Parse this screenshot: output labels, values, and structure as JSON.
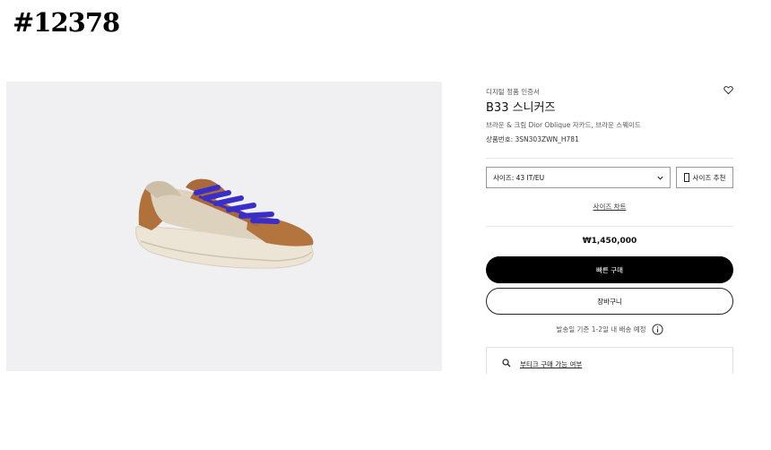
{
  "tag": "#12378",
  "product": {
    "certificate_label": "디지털 정품 인증서",
    "name": "B33 스니커즈",
    "description": "브라운 & 크림 Dior Oblique 자카드, 브라운 스웨이드",
    "code": "상품번호: 3SN303ZWN_H781"
  },
  "size": {
    "select_label": "사이즈: 43  IT/EU",
    "recommend_label": "사이즈 추천",
    "chart_link": "사이즈 차트"
  },
  "price": "₩1,450,000",
  "buttons": {
    "buy_now": "빠른 구매",
    "cart": "장바구니"
  },
  "shipping_note": "발송일 기준 1-2일 내 배송 예정",
  "boutique_link": "부티크 구매 가능 여부",
  "icons": {
    "wishlist": "heart-icon",
    "chevron": "chevron-down-icon",
    "ruler": "ruler-icon",
    "info": "info-icon",
    "search": "search-icon"
  }
}
